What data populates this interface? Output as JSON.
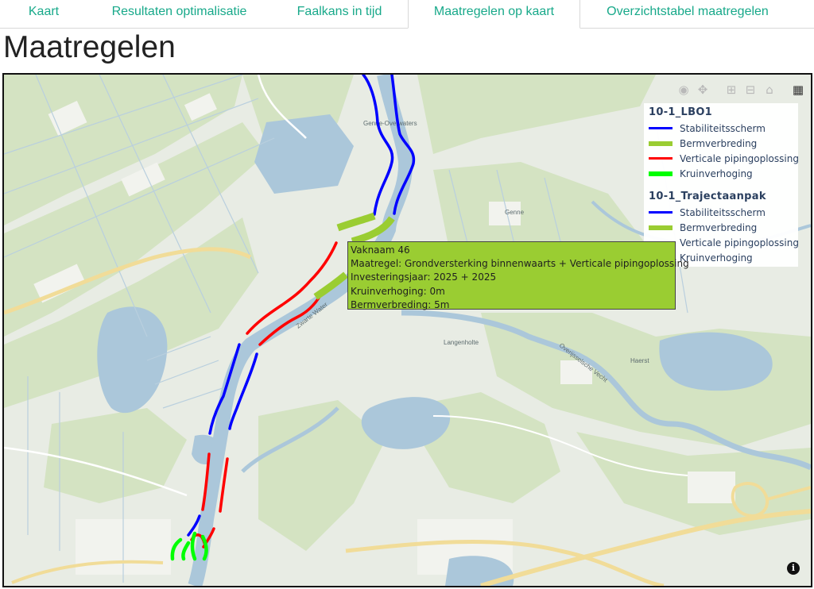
{
  "tabs": [
    {
      "label": "Kaart",
      "active": false
    },
    {
      "label": "Resultaten optimalisatie",
      "active": false
    },
    {
      "label": "Faalkans in tijd",
      "active": false
    },
    {
      "label": "Maatregelen op kaart",
      "active": true
    },
    {
      "label": "Overzichtstabel maatregelen",
      "active": false
    }
  ],
  "page_title": "Maatregelen",
  "map": {
    "place_labels": {
      "genne_overwaters": "Genne-Overwaters",
      "genne": "Genne",
      "zwarte_water": "Zwarte Water",
      "langenholte": "Langenholte",
      "overijsselsche_vecht": "Overijsselsche Vecht",
      "haerst": "Haerst"
    },
    "colors": {
      "land": "#e7ebe2",
      "field": "#d5e4c4",
      "water": "#aac6d9",
      "road": "#f3dd9a",
      "stabiliteitsscherm": "#0000ff",
      "bermverbreding": "#9acd32",
      "verticale_pipingoplossing": "#ff0000",
      "kruinverhoging": "#00ff00"
    }
  },
  "modebar": {
    "icons": [
      "camera-icon",
      "pan-icon",
      "zoom-in-icon",
      "zoom-out-icon",
      "home-icon",
      "table-icon"
    ]
  },
  "legend": {
    "groups": [
      {
        "title": "10-1_LBO1",
        "items": [
          {
            "label": "Stabiliteitsscherm",
            "color": "#0000ff"
          },
          {
            "label": "Bermverbreding",
            "color": "#9acd32"
          },
          {
            "label": "Verticale pipingoplossing",
            "color": "#ff0000"
          },
          {
            "label": "Kruinverhoging",
            "color": "#00ff00"
          }
        ]
      },
      {
        "title": "10-1_Trajectaanpak",
        "items": [
          {
            "label": "Stabiliteitsscherm",
            "color": "#0000ff"
          },
          {
            "label": "Bermverbreding",
            "color": "#9acd32"
          },
          {
            "label": "Verticale pipingoplossing",
            "color": "#ff0000"
          },
          {
            "label": "Kruinverhoging",
            "color": "#00ff00"
          }
        ]
      }
    ]
  },
  "tooltip": {
    "line1": "Vaknaam 46",
    "line2": "Maatregel: Grondversterking binnenwaarts + Verticale pipingoplossing",
    "line3": "Investeringsjaar: 2025 + 2025",
    "line4": "Kruinverhoging: 0m",
    "line5": "Bermverbreding: 5m"
  },
  "info_label": "i"
}
